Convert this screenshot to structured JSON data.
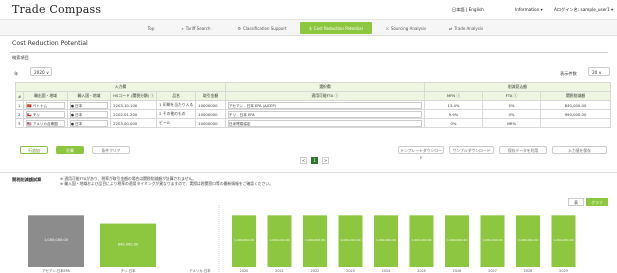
{
  "header": {
    "logo": "Trade Compass",
    "languages": "日本語 | English",
    "information": "Information ▾",
    "login": "Aログイン名: sample_user1 ▾"
  },
  "nav": [
    {
      "label": "Top",
      "icon": ""
    },
    {
      "label": "Tariff Search",
      "icon": "⌕"
    },
    {
      "label": "Classification Support",
      "icon": "⚙"
    },
    {
      "label": "Cost Reduction Potential",
      "icon": "$"
    },
    {
      "label": "Sourcing Analysis",
      "icon": "⛌"
    },
    {
      "label": "Trade Analysis",
      "icon": "⇄"
    }
  ],
  "page": {
    "title": "Cost Reduction Potential",
    "search_section": "検索項目",
    "year_label": "年",
    "year_value": "2020 ∨",
    "count_label": "表示件数",
    "count_value": "20 ∨"
  },
  "table": {
    "group_input": "入力欄",
    "group_select": "選択欄",
    "group_result": "削減見込額",
    "col_hash": "#",
    "col_origin": "輸出国・地域",
    "col_import": "輸入国・地域",
    "col_hs": "HSコード (関税分類) ⓘ",
    "col_item": "品名",
    "col_amount": "取引金額",
    "col_fta": "適用可能FTA ⓘ",
    "col_mfn": "MFN ⓘ",
    "col_ftarate": "FTA ⓘ",
    "col_saving": "関税削減額",
    "rows": [
      {
        "n": "1",
        "origin": "🇻🇳 ベトナム",
        "dest": "● 日本",
        "hs": "2203.10.100",
        "item": "1 印刷を当たり入る",
        "amount": "10000000",
        "fta": "アセアン - 日本 EPA (AJCEP)",
        "mfn": "13.4%",
        "rate": "5%",
        "saving": "840,000.00"
      },
      {
        "n": "2",
        "origin": "🇨🇱 チリ",
        "dest": "● 日本",
        "hs": "2202.01.200",
        "item": "2 その他のもの",
        "amount": "10000000",
        "fta": "チリ - 日本 EPA",
        "mfn": "9.9%",
        "rate": "0%",
        "saving": "990,000.00"
      },
      {
        "n": "3",
        "origin": "🇺🇸 アメリカ合衆国",
        "dest": "● 日本",
        "hs": "2203.00.000",
        "item": "ビール",
        "amount": "10000000",
        "fta": "日米貿易協定",
        "mfn": "0%",
        "rate": "NR%",
        "saving": ""
      }
    ]
  },
  "buttons": {
    "add": "行追加",
    "calc": "計算",
    "clear": "条件クリア",
    "tmpl_dl": "テンプレートダウンロード",
    "sample_dl": "サンプルダウンロード",
    "data_export": "保存データを利用",
    "import": "入力値を保存"
  },
  "pager": {
    "prev": "<",
    "current": "1",
    "next": ">"
  },
  "comparison": {
    "title": "関税削減額試算",
    "note1": "※ 適用可能FTAがあり、税率が取引金額の場合は関税削減額が計算されません。",
    "note2": "※ 輸入国・地域および品目により税率の適用タイミングが異なりますので、実際は税関窓口等の最新情報をご確認ください。",
    "toggle_table": "表",
    "toggle_graph": "グラフ"
  },
  "colors": {
    "accent": "#8dc63f",
    "dark_accent": "#2a7a2a",
    "grey_bar": "#8c8c8c"
  },
  "chart_data": {
    "type": "bar",
    "left": {
      "categories": [
        "アセアン-日本EPA",
        "チリ-日本",
        "アメリカ-日本"
      ],
      "values": [
        1000000,
        840000,
        0
      ],
      "colors": [
        "#8c8c8c",
        "#8dc63f",
        "#8dc63f"
      ],
      "labels": [
        "1,000,000.00",
        "840,000.00",
        ""
      ]
    },
    "right": {
      "categories": [
        "2020",
        "2021",
        "2022",
        "2023",
        "2024",
        "2025",
        "2026",
        "2027",
        "2028",
        "2029"
      ],
      "values": [
        1000000,
        1000000,
        1000000,
        1000000,
        1000000,
        1000000,
        1000000,
        1000000,
        1000000,
        1000000
      ],
      "labels": [
        "1,000,000.00",
        "1,000,000.00",
        "1,000,000.00",
        "1,000,000.00",
        "1,000,000.00",
        "1,000,000.00",
        "1,000,000.00",
        "1,000,000.00",
        "1,000,000.00",
        "1,000,000.00"
      ]
    },
    "ylim": [
      0,
      1200000
    ],
    "grid": false
  }
}
